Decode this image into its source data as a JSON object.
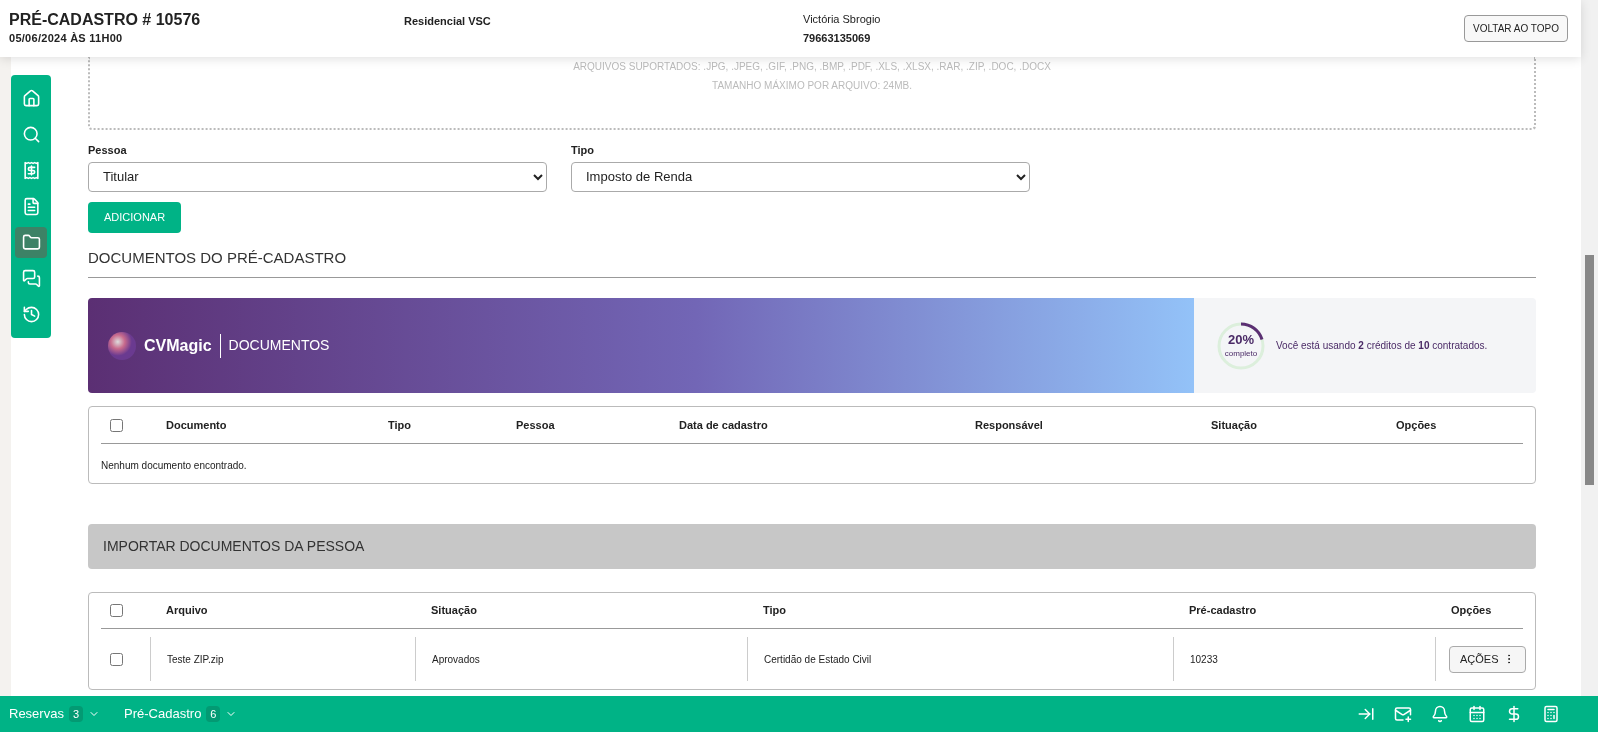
{
  "header": {
    "title": "PRÉ-CADASTRO # 10576",
    "datetime": "05/06/2024 ÀS 11H00",
    "project": "Residencial VSC",
    "client_name": "Victória Sbrogio",
    "client_phone": "79663135069",
    "top_button": "VOLTAR AO TOPO"
  },
  "sidebar": {
    "items": [
      {
        "selected": false
      },
      {
        "selected": false
      },
      {
        "selected": false
      },
      {
        "selected": false
      },
      {
        "selected": true
      },
      {
        "selected": false
      },
      {
        "selected": false
      }
    ]
  },
  "upload": {
    "lines": [
      "ARQUIVOS SUPORTADOS: .JPG, .JPEG, .GIF, .PNG, .BMP, .PDF, .XLS, .XLSX, .RAR, .ZIP, .DOC, .DOCX",
      "TAMANHO MÁXIMO POR ARQUIVO: 24MB."
    ]
  },
  "form": {
    "fields": [
      {
        "label": "Pessoa",
        "value": "Titular"
      },
      {
        "label": "Tipo",
        "value": "Imposto de Renda"
      }
    ],
    "add_button": "ADICIONAR"
  },
  "section_title": "DOCUMENTOS DO PRÉ-CADASTRO",
  "banner": {
    "brand": "CVMagic",
    "product": "DOCUMENTOS",
    "progress": {
      "level": 0.2,
      "percent": "20%",
      "label": "completo"
    },
    "credits": "Você está usando **2** créditos de **10** contratados."
  },
  "documents_table": {
    "columns": [
      "Documento",
      "Tipo",
      "Pessoa",
      "Data de cadastro",
      "Responsável",
      "Situação",
      "Opções"
    ],
    "select_all": false,
    "empty": "Nenhum documento encontrado."
  },
  "import_title": "IMPORTAR DOCUMENTOS DA PESSOA",
  "import_table": {
    "columns": [
      "Arquivo",
      "Situação",
      "Tipo",
      "Pré-cadastro",
      "Opções"
    ],
    "select_all": false,
    "rows": [
      {
        "checked": false,
        "cells": [
          "Teste ZIP.zip",
          "Aprovados",
          "Certidão de Estado Civil",
          "10233"
        ],
        "action": "AÇÕES"
      }
    ]
  },
  "bottom_bar": {
    "items": [
      {
        "label": "Reservas",
        "count": "3"
      },
      {
        "label": "Pré-Cadastro",
        "count": "6"
      }
    ]
  }
}
